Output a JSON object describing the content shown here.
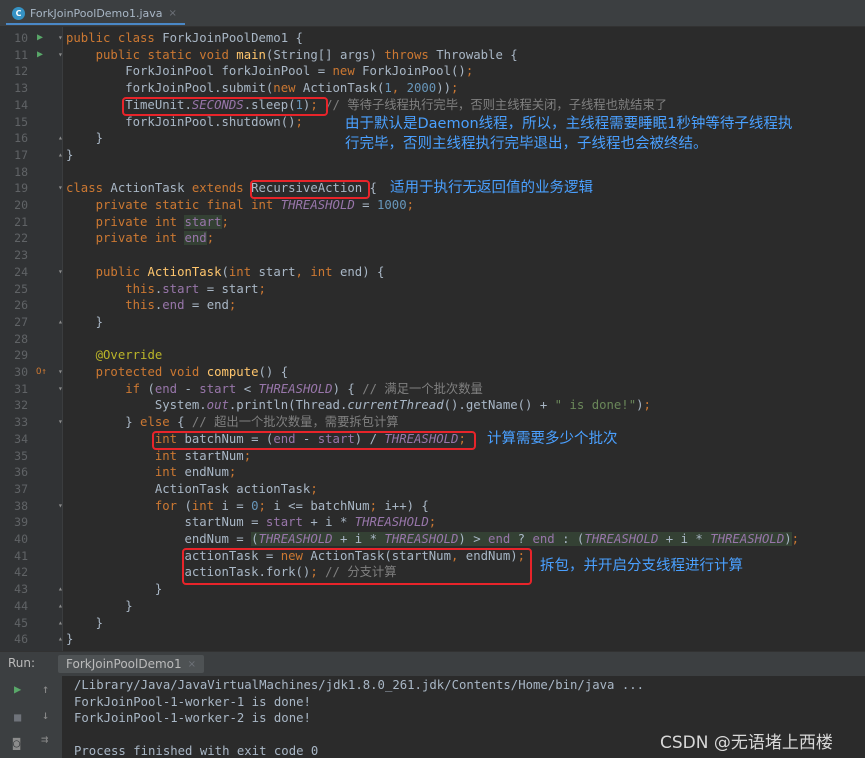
{
  "editor_tab": {
    "icon": "java-class-icon",
    "label": "ForkJoinPoolDemo1.java",
    "close": "×"
  },
  "lines": [
    {
      "n": "10",
      "html": "<span class=\"k\">public class</span> ForkJoinPoolDemo1 {"
    },
    {
      "n": "11",
      "html": "    <span class=\"k\">public static void</span> <span class=\"m\">main</span>(String[] args) <span class=\"k\">throws</span> Throwable {"
    },
    {
      "n": "12",
      "html": "        ForkJoinPool forkJoinPool = <span class=\"k\">new</span> ForkJoinPool()<span class=\"k\">;</span>"
    },
    {
      "n": "13",
      "html": "        forkJoinPool.submit(<span class=\"k\">new</span> ActionTask(<span class=\"n\">1</span><span class=\"k\">,</span> <span class=\"n\">2000</span>))<span class=\"k\">;</span>"
    },
    {
      "n": "14",
      "html": "        TimeUnit.<span class=\"f\">SECONDS</span>.sleep(<span class=\"n\">1</span>)<span class=\"k\">;</span> <span class=\"c\">// 等待子线程执行完毕，否则主线程关闭，子线程也就结束了</span>"
    },
    {
      "n": "15",
      "html": "        forkJoinPool.shutdown()<span class=\"k\">;</span>"
    },
    {
      "n": "16",
      "html": "    }"
    },
    {
      "n": "17",
      "html": "}"
    },
    {
      "n": "18",
      "html": ""
    },
    {
      "n": "19",
      "html": "<span class=\"k\">class</span> ActionTask <span class=\"k\">extends</span> RecursiveAction {"
    },
    {
      "n": "20",
      "html": "    <span class=\"k\">private static final int</span> <span class=\"f\">THREASHOLD</span> = <span class=\"n\">1000</span><span class=\"k\">;</span>"
    },
    {
      "n": "21",
      "html": "    <span class=\"k\">private int</span> <span class=\"fi hl\">start</span><span class=\"k\">;</span>"
    },
    {
      "n": "22",
      "html": "    <span class=\"k\">private int</span> <span class=\"fi hl\">end</span><span class=\"k\">;</span>"
    },
    {
      "n": "23",
      "html": ""
    },
    {
      "n": "24",
      "html": "    <span class=\"k\">public</span> <span class=\"m\">ActionTask</span>(<span class=\"k\">int</span> start<span class=\"k\">,</span> <span class=\"k\">int</span> end) {"
    },
    {
      "n": "25",
      "html": "        <span class=\"k\">this</span>.<span class=\"fi\">start</span> = start<span class=\"k\">;</span>"
    },
    {
      "n": "26",
      "html": "        <span class=\"k\">this</span>.<span class=\"fi\">end</span> = end<span class=\"k\">;</span>"
    },
    {
      "n": "27",
      "html": "    }"
    },
    {
      "n": "28",
      "html": ""
    },
    {
      "n": "29",
      "html": "    <span class=\"an\">@Override</span>"
    },
    {
      "n": "30",
      "html": "    <span class=\"k\">protected void</span> <span class=\"m\">compute</span>() {"
    },
    {
      "n": "31",
      "html": "        <span class=\"k\">if</span> (<span class=\"fi\">end</span> - <span class=\"fi\">start</span> &lt; <span class=\"f\">THREASHOLD</span>) { <span class=\"c\">// 满足一个批次数量</span>"
    },
    {
      "n": "32",
      "html": "            System.<span class=\"f\">out</span>.println(Thread.<span class=\"it\">currentThread</span>().getName() + <span class=\"s\">\" is done!\"</span>)<span class=\"k\">;</span>"
    },
    {
      "n": "33",
      "html": "        } <span class=\"k\">else</span> { <span class=\"c\">// 超出一个批次数量，需要拆包计算</span>"
    },
    {
      "n": "34",
      "html": "            <span class=\"k\">int</span> batchNum = (<span class=\"fi\">end</span> - <span class=\"fi\">start</span>) / <span class=\"f\">THREASHOLD</span><span class=\"k\">;</span>"
    },
    {
      "n": "35",
      "html": "            <span class=\"k\">int</span> startNum<span class=\"k\">;</span>"
    },
    {
      "n": "36",
      "html": "            <span class=\"k\">int</span> endNum<span class=\"k\">;</span>"
    },
    {
      "n": "37",
      "html": "            ActionTask actionTask<span class=\"k\">;</span>"
    },
    {
      "n": "38",
      "html": "            <span class=\"k\">for</span> (<span class=\"k\">int</span> i = <span class=\"n\">0</span><span class=\"k\">;</span> i &lt;= batchNum<span class=\"k\">;</span> i++) {"
    },
    {
      "n": "39",
      "html": "                startNum = <span class=\"fi\">start</span> + i * <span class=\"f\">THREASHOLD</span><span class=\"k\">;</span>"
    },
    {
      "n": "40",
      "html": "                endNum = <span class=\"hl\">(<span class=\"f\">THREASHOLD</span> + i * <span class=\"f\">THREASHOLD</span>) &gt; <span class=\"fi\">end</span> ? <span class=\"fi\">end</span> : (<span class=\"f\">THREASHOLD</span> + i * <span class=\"f\">THREASHOLD</span>)</span><span class=\"k\">;</span>"
    },
    {
      "n": "41",
      "html": "                actionTask = <span class=\"k\">new</span> ActionTask(startNum<span class=\"k\">,</span> endNum)<span class=\"k\">;</span>"
    },
    {
      "n": "42",
      "html": "                actionTask.fork()<span class=\"k\">;</span> <span class=\"c\">// 分支计算</span>"
    },
    {
      "n": "43",
      "html": "            }"
    },
    {
      "n": "44",
      "html": "        }"
    },
    {
      "n": "45",
      "html": "    }"
    },
    {
      "n": "46",
      "html": "}"
    }
  ],
  "notes": {
    "sleep_note_1": "由于默认是Daemon线程，所以，主线程需要睡眠1秒钟等待子线程执",
    "sleep_note_2": "行完毕，否则主线程执行完毕退出，子线程也会被终结。",
    "recursive_note": "适用于执行无返回值的业务逻辑",
    "batch_note": "计算需要多少个批次",
    "fork_note": "拆包，并开启分支线程进行计算"
  },
  "run_panel": {
    "label": "Run:",
    "tab_label": "ForkJoinPoolDemo1",
    "tab_close": "×",
    "output": [
      "/Library/Java/JavaVirtualMachines/jdk1.8.0_261.jdk/Contents/Home/bin/java ...",
      "ForkJoinPool-1-worker-1 is done!",
      "ForkJoinPool-1-worker-2 is done!",
      "",
      "Process finished with exit code 0"
    ]
  },
  "watermark": "CSDN @无语堵上西楼",
  "colors": {
    "keyword": "#cc7832",
    "method": "#ffc66d",
    "number": "#6897bb",
    "comment": "#808080",
    "field": "#9876aa",
    "annotation_box": "#e8242a",
    "note_text": "#4aa0ff"
  }
}
